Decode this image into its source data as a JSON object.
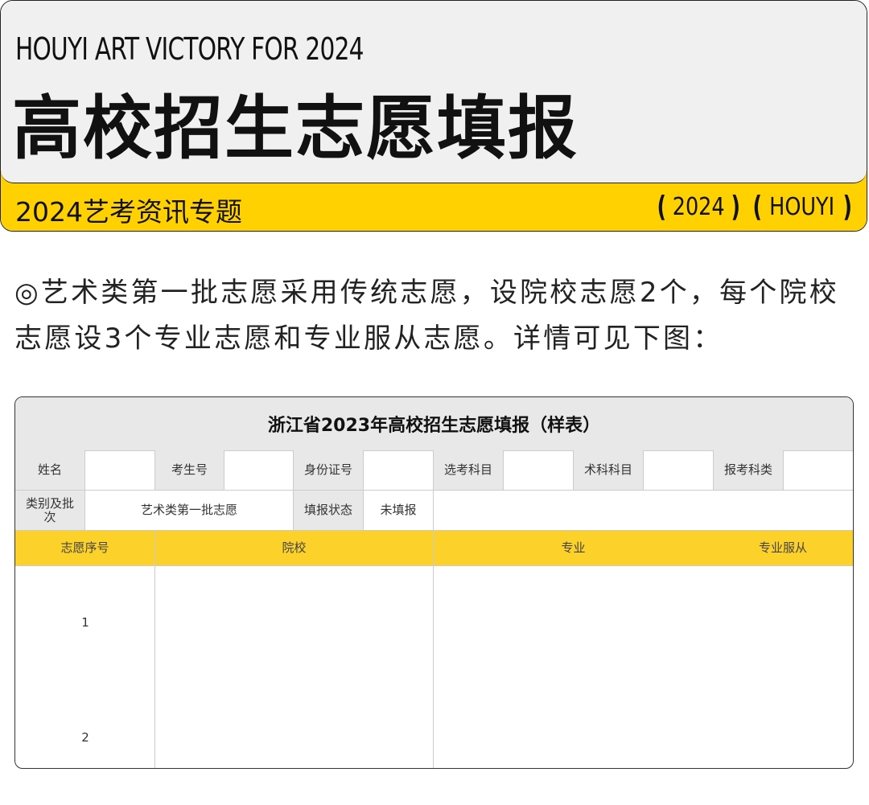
{
  "banner": {
    "subtitle_en": "HOUYI ART VICTORY FOR 2024",
    "title_cn": "高校招生志愿填报",
    "topic": "2024艺考资讯专题",
    "badges": [
      {
        "left": "(",
        "text": "2024",
        "right": ")"
      },
      {
        "left": "(",
        "text": "HOUYI",
        "right": ")"
      }
    ]
  },
  "intro": {
    "text": "◎艺术类第一批志愿采用传统志愿，设院校志愿2个，每个院校志愿设3个专业志愿和专业服从志愿。详情可见下图："
  },
  "form": {
    "title": "浙江省2023年高校招生志愿填报（样表）",
    "row1": {
      "name_label": "姓名",
      "name_value": "",
      "exam_no_label": "考生号",
      "exam_no_value": "",
      "id_label": "身份证号",
      "id_value": "",
      "subject_label": "选考科目",
      "subject_value": "",
      "art_subject_label": "术科科目",
      "art_subject_value": "",
      "category_label": "报考科类",
      "category_value": ""
    },
    "row2": {
      "batch_label": "类别及批次",
      "batch_value": "艺术类第一批志愿",
      "status_label": "填报状态",
      "status_value": "未填报"
    },
    "headers": {
      "seq": "志愿序号",
      "school": "院校",
      "major": "专业",
      "obey": "专业服从"
    },
    "rows": [
      {
        "seq": "1"
      },
      {
        "seq": "2"
      }
    ]
  },
  "colors": {
    "accent_yellow": "#ffd100",
    "header_yellow": "#fcd12a",
    "label_gray": "#e8e8e8"
  }
}
